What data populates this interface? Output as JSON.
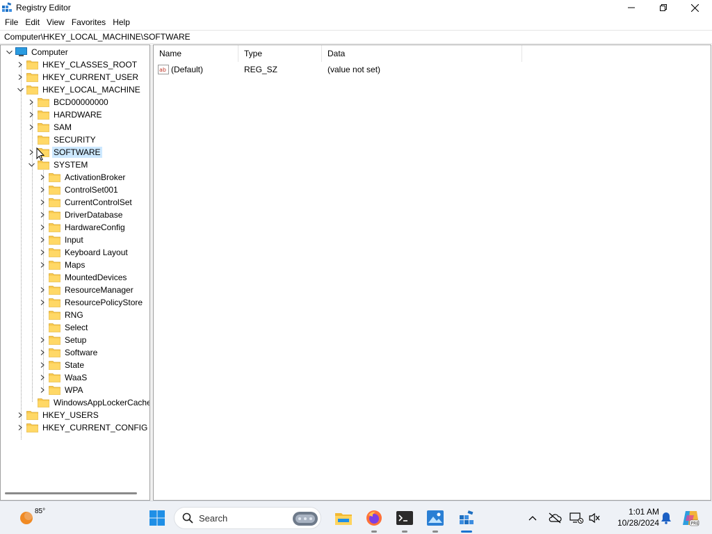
{
  "window": {
    "title": "Registry Editor",
    "minimize_icon": "minimize-icon",
    "maximize_icon": "restore-icon",
    "close_icon": "close-icon"
  },
  "menu": [
    "File",
    "Edit",
    "View",
    "Favorites",
    "Help"
  ],
  "address": "Computer\\HKEY_LOCAL_MACHINE\\SOFTWARE",
  "tree": {
    "root": "Computer",
    "hives": [
      "HKEY_CLASSES_ROOT",
      "HKEY_CURRENT_USER",
      "HKEY_LOCAL_MACHINE",
      "HKEY_USERS",
      "HKEY_CURRENT_CONFIG"
    ],
    "hklm_children": [
      "BCD00000000",
      "HARDWARE",
      "SAM",
      "SECURITY",
      "SOFTWARE",
      "SYSTEM"
    ],
    "system_children": [
      "ActivationBroker",
      "ControlSet001",
      "CurrentControlSet",
      "DriverDatabase",
      "HardwareConfig",
      "Input",
      "Keyboard Layout",
      "Maps",
      "MountedDevices",
      "ResourceManager",
      "ResourcePolicyStore",
      "RNG",
      "Select",
      "Setup",
      "Software",
      "State",
      "WaaS",
      "WPA"
    ],
    "after_system": "WindowsAppLockerCache",
    "selected": "SOFTWARE"
  },
  "list": {
    "columns": [
      "Name",
      "Type",
      "Data"
    ],
    "rows": [
      {
        "name": "(Default)",
        "type": "REG_SZ",
        "data": "(value not set)",
        "icon": "string-value-icon"
      }
    ]
  },
  "taskbar": {
    "weather_temp": "85°",
    "search_placeholder": "Search",
    "time": "1:01 AM",
    "date": "10/28/2024",
    "apps": [
      "file-explorer-icon",
      "firefox-icon",
      "terminal-icon",
      "image-viewer-icon",
      "registry-editor-icon"
    ]
  },
  "colors": {
    "selection": "#cce8ff",
    "folder": "#f8c94f",
    "accent": "#1a73d0"
  }
}
